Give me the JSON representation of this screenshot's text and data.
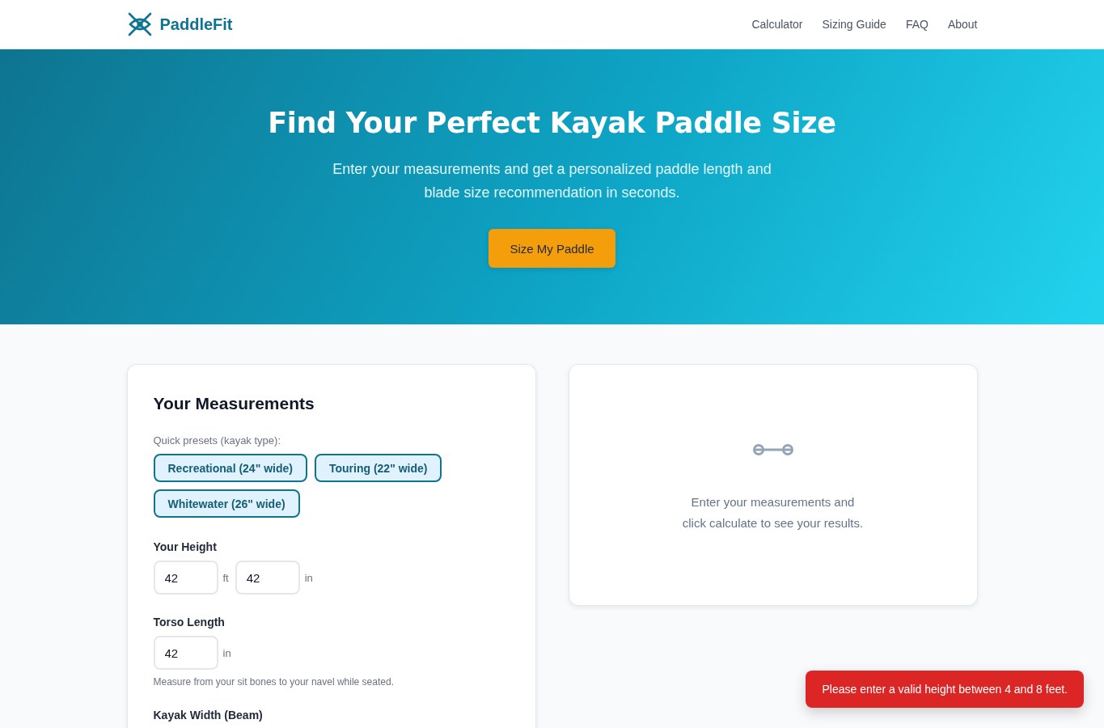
{
  "header": {
    "brand": "PaddleFit",
    "nav": [
      "Calculator",
      "Sizing Guide",
      "FAQ",
      "About"
    ]
  },
  "hero": {
    "title": "Find Your Perfect Kayak Paddle Size",
    "subtitle": "Enter your measurements and get a personalized paddle length and blade size recommendation in seconds.",
    "button": "Size My Paddle"
  },
  "measurements": {
    "title": "Your Measurements",
    "presets_label": "Quick presets (kayak type):",
    "presets": [
      "Recreational (24\" wide)",
      "Touring (22\" wide)",
      "Whitewater (26\" wide)"
    ],
    "fields": [
      {
        "label": "Your Height",
        "inputs": [
          {
            "value": "42",
            "unit": "ft"
          },
          {
            "value": "42",
            "unit": "in"
          }
        ]
      },
      {
        "label": "Torso Length",
        "inputs": [
          {
            "value": "42",
            "unit": "in"
          }
        ],
        "hint": "Measure from your sit bones to your navel while seated."
      },
      {
        "label": "Kayak Width (Beam)"
      }
    ]
  },
  "results": {
    "message": "Enter your measurements and click calculate to see your results."
  },
  "toast": {
    "message": "Please enter a valid height between 4 and 8 feet."
  }
}
